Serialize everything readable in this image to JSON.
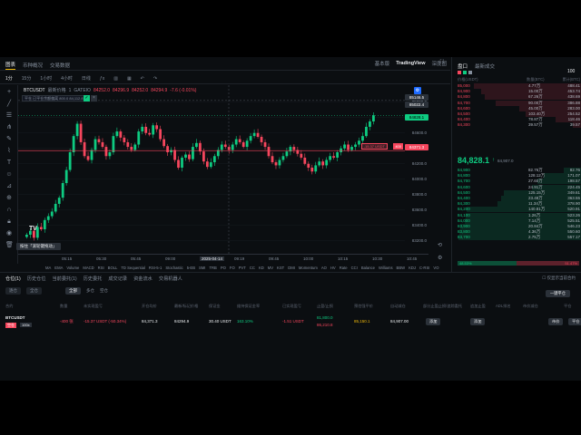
{
  "header_tabs": [
    {
      "label": "图表",
      "active": true
    },
    {
      "label": "币种概况",
      "active": false
    },
    {
      "label": "交易数据",
      "active": false
    }
  ],
  "chart_views": [
    {
      "label": "基本版",
      "active": false
    },
    {
      "label": "TradingView",
      "active": true
    },
    {
      "label": "深度图",
      "active": false
    }
  ],
  "timeframes": [
    {
      "label": "1分",
      "active": true
    },
    {
      "label": "15分"
    },
    {
      "label": "1小时"
    },
    {
      "label": "4小时"
    },
    {
      "label": "日线"
    }
  ],
  "legend": {
    "symbol": "BTCUSDT",
    "mark_label": "最新价格",
    "interval": "1",
    "exchange": "GATEIO",
    "o": "84252.0",
    "h": "84296.9",
    "l": "84252.0",
    "c": "84294.9",
    "change": "-7.6 (-0.01%)"
  },
  "price_box_text": "平仓 已平仓余额偏离 800.0 84,112.8",
  "price_axis": [
    "85000.0",
    "84800.0",
    "84600.0",
    "84400.0",
    "84200.0",
    "84000.0",
    "83800.0",
    "83600.0",
    "83400.0",
    "83200.0"
  ],
  "price_labels": {
    "top1": "85146.5",
    "top2": "85022.4",
    "current": "84828.1",
    "position": "84371.3",
    "position_tag": "400"
  },
  "position_line_text": "-15.37 USDT",
  "time_axis": [
    "05:15",
    "05:30",
    "05:45",
    "09:00",
    "2025-04-14",
    "09:19",
    "09:45",
    "10:00",
    "10:15",
    "10:30",
    "10:45"
  ],
  "indicators": [
    "MA",
    "EMA",
    "Volume",
    "MACD",
    "RSI",
    "BOLL",
    "TD Sequential",
    "RSI-5-1",
    "Stochastic",
    "5-EB",
    "SMI",
    "TRB",
    "PO",
    "FO",
    "PVT",
    "CC",
    "KD",
    "MV",
    "KST",
    "DMI",
    "Momentum",
    "AO",
    "HV",
    "Rate",
    "CCI",
    "Balance",
    "Williams",
    "BBW",
    "KDJ",
    "C-RSI",
    "VO"
  ],
  "tooltip": "按住「滚轮键拖动」",
  "orderbook": {
    "tabs": [
      {
        "label": "盘口",
        "active": true
      },
      {
        "label": "最新成交",
        "active": false
      }
    ],
    "step": "100",
    "headers": [
      "价格(USDT)",
      "数量(BTC)",
      "累计(BTC)"
    ],
    "asks": [
      [
        "85,000",
        "4.77万",
        "488.41"
      ],
      [
        "84,900",
        "15.00万",
        "453.74"
      ],
      [
        "84,800",
        "67.26万",
        "438.69"
      ],
      [
        "84,700",
        "90.00万",
        "386.88"
      ],
      [
        "84,600",
        "45.00万",
        "283.00"
      ],
      [
        "84,500",
        "103.40万",
        "254.52"
      ],
      [
        "84,400",
        "78.87万",
        "118.46"
      ],
      [
        "84,300",
        "39.57万",
        "39.57"
      ]
    ],
    "mid_price": "84,828.1",
    "mid_arrow": "↑",
    "mid_sub": "84,907.0",
    "bids": [
      [
        "84,900",
        "82.76万",
        "82.76"
      ],
      [
        "84,800",
        "128.12万",
        "171.07"
      ],
      [
        "84,700",
        "27.60万",
        "198.57"
      ],
      [
        "84,600",
        "24.91万",
        "224.45"
      ],
      [
        "84,500",
        "125.15万",
        "349.61"
      ],
      [
        "84,400",
        "23.48万",
        "363.55"
      ],
      [
        "84,300",
        "11.34万",
        "378.90"
      ],
      [
        "84,200",
        "140.81万",
        "520.91"
      ],
      [
        "84,100",
        "1.26万",
        "523.26"
      ],
      [
        "84,000",
        "7.14万",
        "525.51"
      ],
      [
        "83,900",
        "20.84万",
        "546.23"
      ],
      [
        "83,800",
        "4.36万",
        "550.60"
      ],
      [
        "83,700",
        "2.75万",
        "557.17"
      ]
    ],
    "ratio_buy": "48.53%",
    "ratio_sell": "51.47%"
  },
  "bottom": {
    "tabs": [
      {
        "label": "仓位(1)",
        "active": true
      },
      {
        "label": "历史仓位",
        "active": false
      },
      {
        "label": "当前委托(1)",
        "active": false
      },
      {
        "label": "历史委托",
        "active": false
      },
      {
        "label": "成交记录",
        "active": false
      },
      {
        "label": "资金流水",
        "active": false
      },
      {
        "label": "交易机器人",
        "active": false
      }
    ],
    "hide_others": "仅显示当前合约",
    "filter_a": "逐仓",
    "filter_b": "全仓",
    "filter_all": "全部",
    "filter_long": "多仓",
    "filter_short": "空仓",
    "close_all": "一键平仓",
    "columns": [
      "合约",
      "数量",
      "未实现盈亏",
      "开仓均价",
      "最新/标记价格",
      "保证金",
      "维持保证金率",
      "已实现盈亏",
      "止盈/止损",
      "预估强平价",
      "自动减仓",
      "部分止盈止损/追踪委托",
      "追加止盈",
      "ADL排名",
      "市价减仓",
      "平仓"
    ],
    "row": {
      "symbol": "BTCUSDT",
      "side": "空仓",
      "leverage": "100x",
      "qty": "-400 张",
      "pnl": "-15.37 USDT (-50.34%)",
      "entry": "84,371.3",
      "mark": "84294.9",
      "margin": "30.40 USDT",
      "mm_rate": "163.10%",
      "realized": "-1.51 USDT",
      "tp": "81,800.0",
      "sl": "86,210.8",
      "liq": "85,150.1",
      "last": "84,907.00",
      "add": "添加",
      "add2": "添加",
      "btn_close": "市价",
      "btn_close2": "平仓"
    }
  },
  "colors": {
    "up": "#0ecb81",
    "down": "#f6465d",
    "accent": "#f0b90b",
    "bg": "#0b0e11"
  },
  "chart_data": {
    "type": "candlestick",
    "symbol": "BTCUSDT",
    "interval": "1",
    "ylim": [
      83150,
      85150
    ],
    "x_ticks": [
      "05:15",
      "05:30",
      "05:45",
      "09:00",
      "2025-04-14",
      "09:19",
      "09:45",
      "10:00",
      "10:15",
      "10:30",
      "10:45"
    ],
    "closes": [
      83280,
      83330,
      83240,
      83380,
      83350,
      83470,
      83520,
      83580,
      83680,
      83760,
      83950,
      84120,
      84350,
      84560,
      84720,
      84480,
      84300,
      84250,
      84380,
      84520,
      84480,
      84420,
      84300,
      84350,
      84560,
      84620,
      84540,
      84480,
      84420,
      84380,
      84450,
      84620,
      84680,
      84600,
      84580,
      84700,
      84650,
      84520,
      84430,
      84350,
      84380,
      84250,
      84150,
      84280,
      84320,
      84260,
      84420,
      84470,
      84360,
      84230,
      84160,
      84220,
      84300,
      84380,
      84450,
      84420,
      84380,
      84450,
      84520,
      84480,
      84420,
      84500,
      84560,
      84600,
      84550,
      84480,
      84420,
      84300,
      84220,
      84180,
      84250,
      84300,
      84360,
      84420,
      84380,
      84330,
      84280,
      84200,
      84150,
      84100,
      84180,
      84230,
      84180,
      84250,
      84300,
      84280,
      84350,
      84400,
      84450,
      84380,
      84420,
      84450,
      84500,
      84560,
      84680,
      84750,
      84830
    ]
  }
}
